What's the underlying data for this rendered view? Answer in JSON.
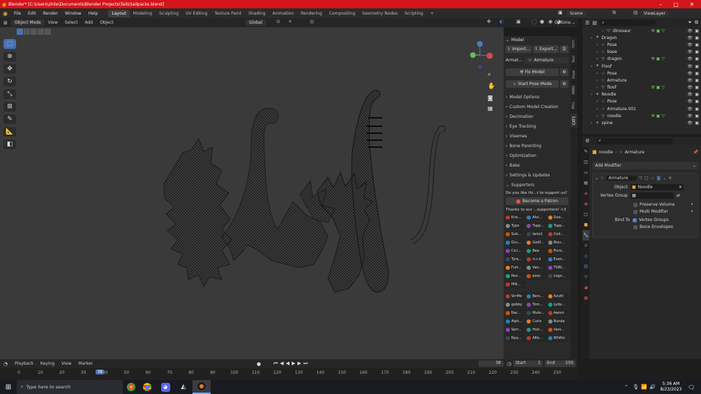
{
  "titlebar": {
    "title": "Blender* [C:\\Users\\zhile\\Documents\\Blender Projects\\Tails\\tailpacks.blend]",
    "minimize": "–",
    "maximize": "□",
    "close": "✕"
  },
  "menu": [
    "File",
    "Edit",
    "Render",
    "Window",
    "Help"
  ],
  "workspaces": [
    "Layout",
    "Modeling",
    "Sculpting",
    "UV Editing",
    "Texture Paint",
    "Shading",
    "Animation",
    "Rendering",
    "Compositing",
    "Geometry Nodes",
    "Scripting",
    "+"
  ],
  "scene": {
    "label": "Scene",
    "viewlayer": "ViewLayer"
  },
  "viewport_header": {
    "mode": "Object Mode",
    "menus": [
      "View",
      "Select",
      "Add",
      "Object"
    ],
    "transform": "Global",
    "options": "Options ⌄"
  },
  "npanel": {
    "header": "Model",
    "import": "Import...",
    "export": "Export...",
    "armature_label": "Armat...",
    "armature_value": "Armature",
    "fix_model": "Fix Model",
    "start_pose": "Start Pose Mode",
    "sections": [
      "Model Options",
      "Custom Model Creation",
      "Decimation",
      "Eye Tracking",
      "Visemes",
      "Bone Parenting",
      "Optimization",
      "Bake",
      "Settings & Updates"
    ],
    "supporters_header": "Supporters",
    "support_question": "Do you like thi...t to support us?",
    "patron_button": "Become a Patron",
    "thanks": "Thanks to our ...supporters! <3",
    "supporters": [
      "Kris...",
      "Alvi...",
      "Goo...",
      "Typo",
      "Tupp...",
      "Tupp...",
      "Sub...",
      "Ianis1",
      "Cod...",
      "Gru...",
      "Godf...",
      "Rizu...",
      "Cici...",
      "Bee",
      "Finni...",
      "Tyra...",
      "ri.c.k",
      "Even...",
      "Furt...",
      "Van...",
      "TORI...",
      "Rez...",
      "poss",
      "Logo...",
      "Milt..."
    ],
    "supporters2": [
      "Str4fe",
      "Bers...",
      "Azuth",
      "gobby",
      "Tom...",
      "Lyda...",
      "Nar...",
      "Mute...",
      "Awnni",
      "Alph...",
      "Curio",
      "Runda",
      "Serr...",
      "Huti...",
      "Vani...",
      "Nya...",
      "Afto...",
      "Whittz"
    ],
    "tabs": [
      "Item",
      "Tool",
      "View",
      "MMD",
      "Misc",
      "CATS"
    ]
  },
  "outliner": {
    "rows": [
      {
        "indent": 3,
        "icon": "▽",
        "label": "dinosaur",
        "vis": true,
        "color": "#e8a34b"
      },
      {
        "indent": 1,
        "icon": "⯆",
        "label": "Dragon",
        "vis": false,
        "color": "#e8a34b"
      },
      {
        "indent": 2,
        "icon": "☆",
        "label": "Pose",
        "vis": false,
        "color": "#4ab7c9"
      },
      {
        "indent": 2,
        "icon": "☆",
        "label": "base",
        "vis": false,
        "color": "#4ab7c9"
      },
      {
        "indent": 2,
        "icon": "▽",
        "label": "dragon",
        "vis": true,
        "color": "#e8a34b"
      },
      {
        "indent": 1,
        "icon": "⯆",
        "label": "Floof",
        "vis": false,
        "color": "#e8a34b"
      },
      {
        "indent": 2,
        "icon": "☆",
        "label": "Pose",
        "vis": false,
        "color": "#4ab7c9"
      },
      {
        "indent": 2,
        "icon": "☆",
        "label": "Armature",
        "vis": false,
        "color": "#4ab7c9"
      },
      {
        "indent": 2,
        "icon": "▽",
        "label": "floof",
        "vis": true,
        "color": "#e8a34b"
      },
      {
        "indent": 1,
        "icon": "⯆",
        "label": "Noodle",
        "vis": false,
        "color": "#e8a34b"
      },
      {
        "indent": 2,
        "icon": "☆",
        "label": "Pose",
        "vis": false,
        "color": "#4ab7c9"
      },
      {
        "indent": 2,
        "icon": "☆",
        "label": "Armature.001",
        "vis": false,
        "color": "#4ab7c9"
      },
      {
        "indent": 2,
        "icon": "▽",
        "label": "noodle",
        "vis": true,
        "color": "#e8a34b"
      },
      {
        "indent": 1,
        "icon": "⯆",
        "label": "spine",
        "vis": false,
        "color": "#9a9a9a"
      }
    ]
  },
  "properties": {
    "breadcrumb_object": "noodle",
    "breadcrumb_modifier": "Armature",
    "add_modifier": "Add Modifier",
    "modifier_name": "Armature",
    "object_label": "Object",
    "object_value": "Noodle",
    "vgroup_label": "Vertex Group",
    "preserve_volume": "Preserve Volume",
    "multi_modifier": "Multi Modifier",
    "bind_to": "Bind To",
    "vertex_groups": "Vertex Groups",
    "bone_envelopes": "Bone Envelopes"
  },
  "timeline": {
    "playback": "Playback",
    "keying": "Keying",
    "view": "View",
    "marker": "Marker",
    "current_frame": "38",
    "start_label": "Start",
    "start": "1",
    "end_label": "End",
    "end": "250",
    "ticks": [
      "0",
      "10",
      "20",
      "30",
      "40",
      "50",
      "60",
      "70",
      "80",
      "90",
      "100",
      "110",
      "120",
      "130",
      "140",
      "150",
      "160",
      "170",
      "180",
      "190",
      "200",
      "210",
      "220",
      "230",
      "240",
      "250"
    ]
  },
  "taskbar": {
    "search": "Type here to search",
    "time": "5:36 AM",
    "date": "8/23/2023"
  },
  "colors": {
    "title_red": "#d4141b",
    "active_blue": "#4772b3",
    "object_orange": "#e8a34b",
    "bone_teal": "#4ab7c9",
    "vis_green": "#6fcf5a"
  }
}
